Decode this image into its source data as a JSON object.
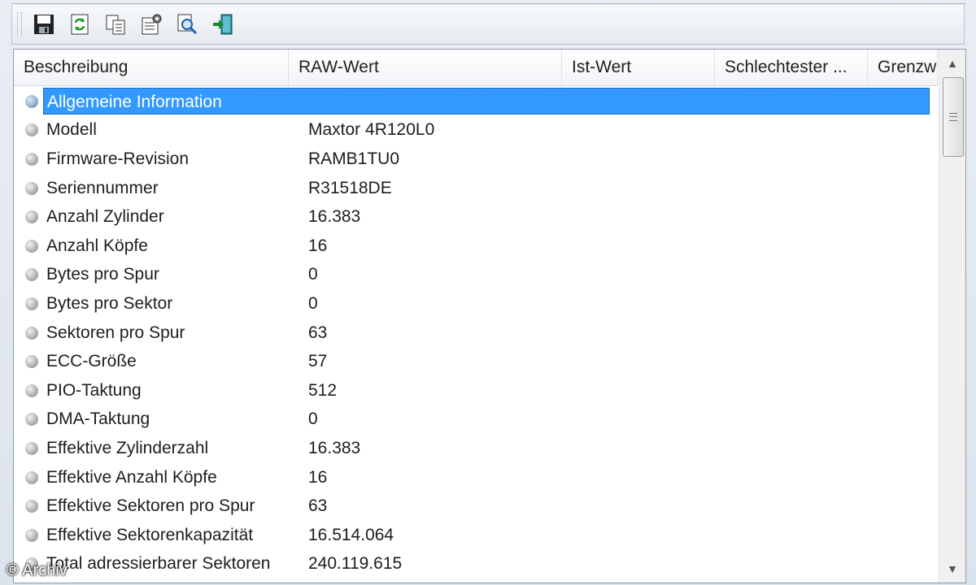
{
  "toolbar": {
    "buttons": [
      {
        "icon": "save-icon"
      },
      {
        "icon": "refresh-icon"
      },
      {
        "icon": "copy-icon"
      },
      {
        "icon": "properties-icon"
      },
      {
        "icon": "search-icon"
      },
      {
        "icon": "exit-icon"
      }
    ]
  },
  "columns": [
    "Beschreibung",
    "RAW-Wert",
    "Ist-Wert",
    "Schlechtester ...",
    "Grenzw"
  ],
  "rows": [
    {
      "label": "Allgemeine Information",
      "raw": "",
      "selected": true
    },
    {
      "label": "Modell",
      "raw": "Maxtor 4R120L0"
    },
    {
      "label": "Firmware-Revision",
      "raw": "RAMB1TU0"
    },
    {
      "label": "Seriennummer",
      "raw": "R31518DE"
    },
    {
      "label": "Anzahl Zylinder",
      "raw": "16.383"
    },
    {
      "label": "Anzahl Köpfe",
      "raw": "16"
    },
    {
      "label": "Bytes pro Spur",
      "raw": "0"
    },
    {
      "label": "Bytes pro Sektor",
      "raw": "0"
    },
    {
      "label": "Sektoren pro Spur",
      "raw": "63"
    },
    {
      "label": "ECC-Größe",
      "raw": "57"
    },
    {
      "label": "PIO-Taktung",
      "raw": "512"
    },
    {
      "label": "DMA-Taktung",
      "raw": "0"
    },
    {
      "label": "Effektive Zylinderzahl",
      "raw": "16.383"
    },
    {
      "label": "Effektive Anzahl Köpfe",
      "raw": "16"
    },
    {
      "label": "Effektive Sektoren pro Spur",
      "raw": "63"
    },
    {
      "label": "Effektive Sektorenkapazität",
      "raw": "16.514.064"
    },
    {
      "label": "Total adressierbarer Sektoren",
      "raw": "240.119.615"
    }
  ],
  "watermark": "© Archiv",
  "colors": {
    "selection": "#3399ff",
    "bullet": "#a3a3a3",
    "bullet_selected": "#7ea3c6"
  }
}
